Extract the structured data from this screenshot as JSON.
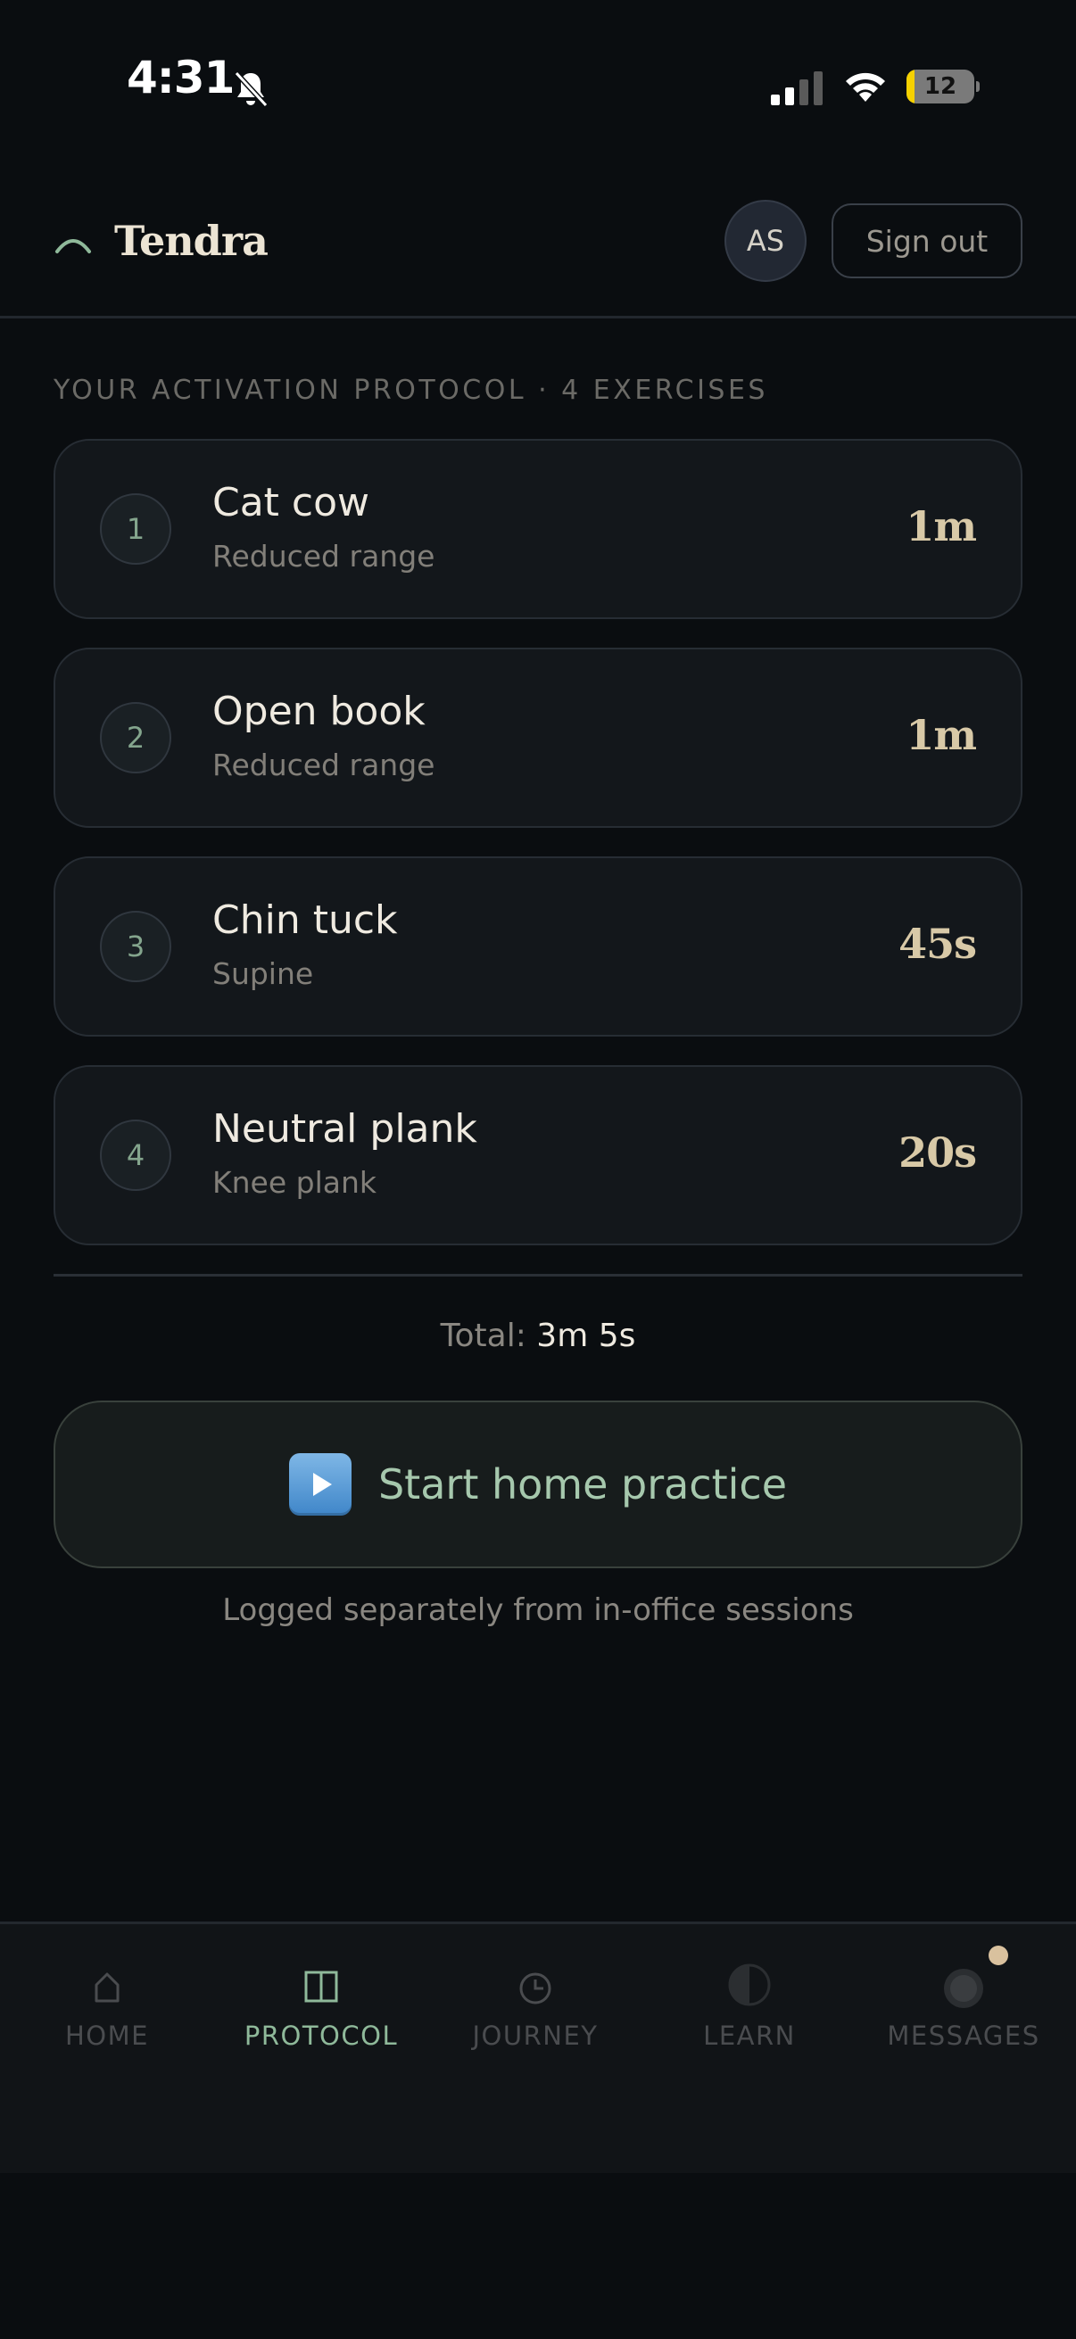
{
  "status_bar": {
    "time": "4:31",
    "battery": "12",
    "battery_level": 0.12,
    "icons": [
      "bell-slash-icon",
      "cellular-signal-icon",
      "wifi-icon",
      "battery-charging-icon"
    ]
  },
  "header": {
    "brand": "Tendra",
    "avatar_initials": "AS",
    "sign_out_label": "Sign out"
  },
  "protocol": {
    "section_label": "YOUR ACTIVATION PROTOCOL · 4 EXERCISES",
    "exercises": [
      {
        "number": "1",
        "name": "Cat cow",
        "variant": "Reduced range",
        "duration": "1m"
      },
      {
        "number": "2",
        "name": "Open book",
        "variant": "Reduced range",
        "duration": "1m"
      },
      {
        "number": "3",
        "name": "Chin tuck",
        "variant": "Supine",
        "duration": "45s"
      },
      {
        "number": "4",
        "name": "Neutral plank",
        "variant": "Knee plank",
        "duration": "20s"
      }
    ],
    "total_label": "Total:",
    "total_value": "3m 5s"
  },
  "start": {
    "label": "Start home practice",
    "icon": "play-button-icon",
    "note": "Logged separately from in-office sessions"
  },
  "tabs": [
    {
      "label": "HOME",
      "icon": "home-icon",
      "active": false
    },
    {
      "label": "PROTOCOL",
      "icon": "columns-icon",
      "active": true
    },
    {
      "label": "JOURNEY",
      "icon": "clock-icon",
      "active": false
    },
    {
      "label": "LEARN",
      "icon": "half-circle-icon",
      "active": false
    },
    {
      "label": "MESSAGES",
      "icon": "message-icon",
      "active": false,
      "unread": true
    }
  ],
  "colors": {
    "background": "#0a0d10",
    "accent": "#8fb99a",
    "duration": "#d8c9a7",
    "card": "#13171b"
  }
}
